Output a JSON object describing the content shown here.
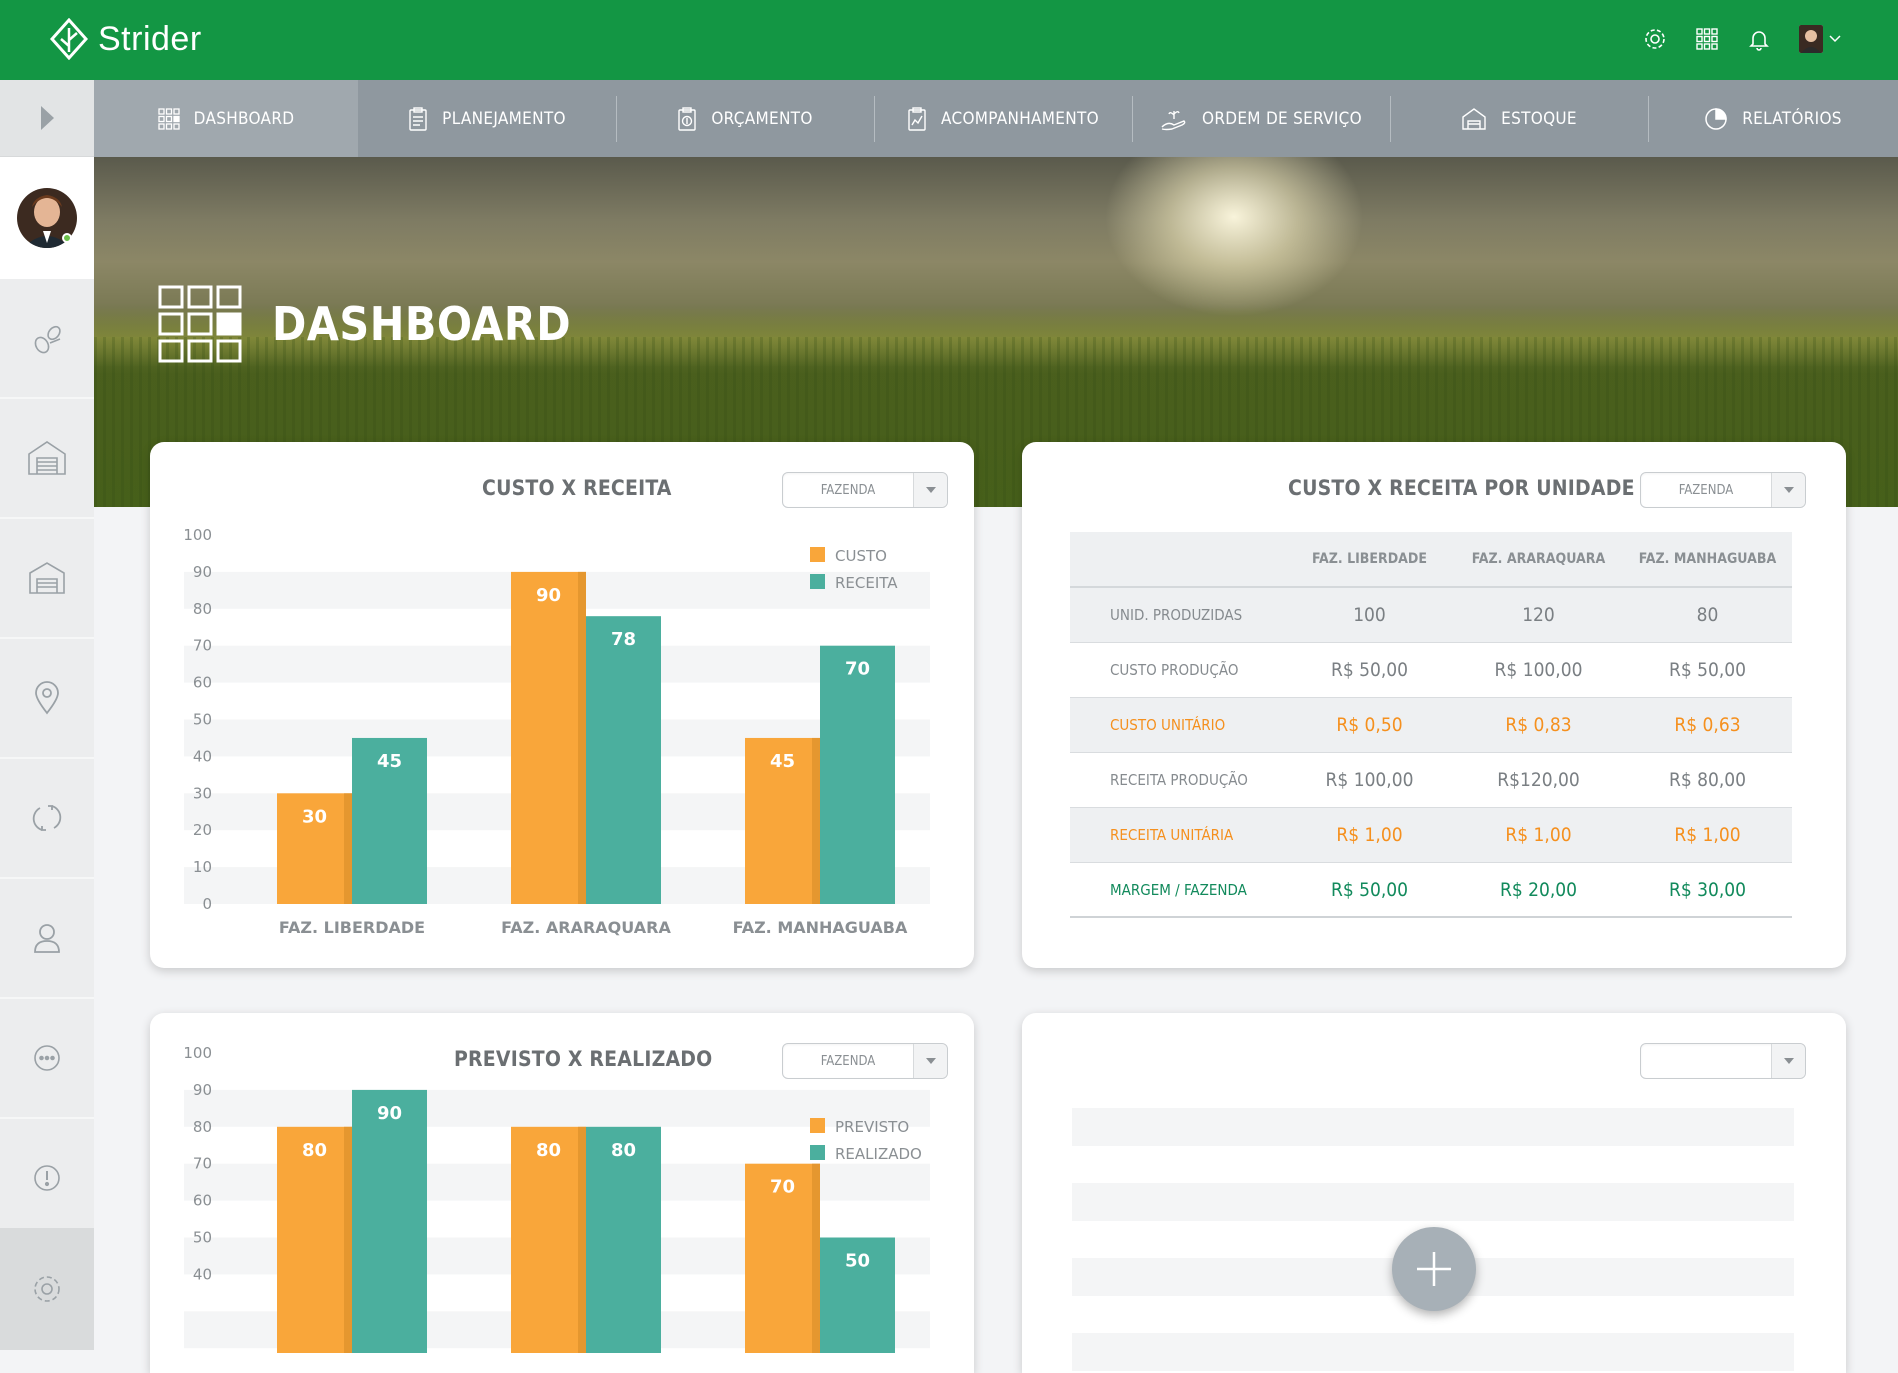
{
  "app": {
    "name": "Strider"
  },
  "nav": {
    "items": [
      {
        "label": "DASHBOARD",
        "icon": "dashboard-grid-icon",
        "active": true
      },
      {
        "label": "PLANEJAMENTO",
        "icon": "clipboard-icon"
      },
      {
        "label": "ORÇAMENTO",
        "icon": "budget-icon"
      },
      {
        "label": "ACOMPANHAMENTO",
        "icon": "tracking-chart-icon"
      },
      {
        "label": "ORDEM DE SERVIÇO",
        "icon": "service-order-icon"
      },
      {
        "label": "ESTOQUE",
        "icon": "warehouse-icon"
      },
      {
        "label": "RELATÓRIOS",
        "icon": "pie-report-icon"
      }
    ]
  },
  "sidebar": {
    "items": [
      "seeds-icon",
      "barn-icon",
      "warehouse-icon",
      "location-pin-icon",
      "sync-icon",
      "user-icon",
      "more-icon",
      "alert-icon"
    ],
    "settings": "gear-icon"
  },
  "page": {
    "title": "DASHBOARD"
  },
  "colors": {
    "brand": "#139644",
    "custo": "#f9a63a",
    "receita": "#4baf9e",
    "orange_text": "#f5901e",
    "green_text": "#128a5c"
  },
  "cards": {
    "custo_receita": {
      "title": "CUSTO X RECEITA",
      "select": "FAZENDA"
    },
    "custo_receita_unidade": {
      "title": "CUSTO X RECEITA POR UNIDADE",
      "select": "FAZENDA"
    },
    "previsto_realizado": {
      "title": "PREVISTO X REALIZADO",
      "select": "FAZENDA"
    },
    "empty": {
      "select": ""
    }
  },
  "chart_data": [
    {
      "type": "bar",
      "title": "CUSTO X RECEITA",
      "categories": [
        "FAZ. LIBERDADE",
        "FAZ. ARARAQUARA",
        "FAZ. MANHAGUABA"
      ],
      "series": [
        {
          "name": "CUSTO",
          "values": [
            30,
            90,
            45
          ]
        },
        {
          "name": "RECEITA",
          "values": [
            45,
            78,
            70
          ]
        }
      ],
      "yticks": [
        "100",
        "90",
        "80",
        "70",
        "60",
        "50",
        "40",
        "30",
        "20",
        "10",
        "0"
      ],
      "ylim": [
        0,
        100
      ],
      "legend": "top-right",
      "grid": true
    },
    {
      "type": "bar",
      "title": "PREVISTO X REALIZADO",
      "categories": [
        "",
        "",
        ""
      ],
      "series": [
        {
          "name": "PREVISTO",
          "values": [
            80,
            80,
            70
          ]
        },
        {
          "name": "REALIZADO",
          "values": [
            90,
            80,
            50
          ]
        }
      ],
      "yticks": [
        "100",
        "90",
        "80",
        "70",
        "60",
        "50",
        "40"
      ],
      "ylim": [
        0,
        100
      ],
      "legend": "top-right",
      "grid": true
    }
  ],
  "table": {
    "headers": [
      "",
      "FAZ. LIBERDADE",
      "FAZ. ARARAQUARA",
      "FAZ. MANHAGUABA"
    ],
    "rows": [
      {
        "label": "UNID. PRODUZIDAS",
        "values": [
          "100",
          "120",
          "80"
        ],
        "style": "shade"
      },
      {
        "label": "CUSTO PRODUÇÃO",
        "values": [
          "R$ 50,00",
          "R$ 100,00",
          "R$ 50,00"
        ],
        "style": ""
      },
      {
        "label": "CUSTO UNITÁRIO",
        "values": [
          "R$ 0,50",
          "R$ 0,83",
          "R$ 0,63"
        ],
        "style": "shade orange"
      },
      {
        "label": "RECEITA PRODUÇÃO",
        "values": [
          "R$ 100,00",
          "R$120,00",
          "R$ 80,00"
        ],
        "style": ""
      },
      {
        "label": "RECEITA UNITÁRIA",
        "values": [
          "R$ 1,00",
          "R$ 1,00",
          "R$ 1,00"
        ],
        "style": "shade orange"
      },
      {
        "label": "MARGEM / FAZENDA",
        "values": [
          "R$ 50,00",
          "R$ 20,00",
          "R$ 30,00"
        ],
        "style": "green"
      }
    ]
  }
}
